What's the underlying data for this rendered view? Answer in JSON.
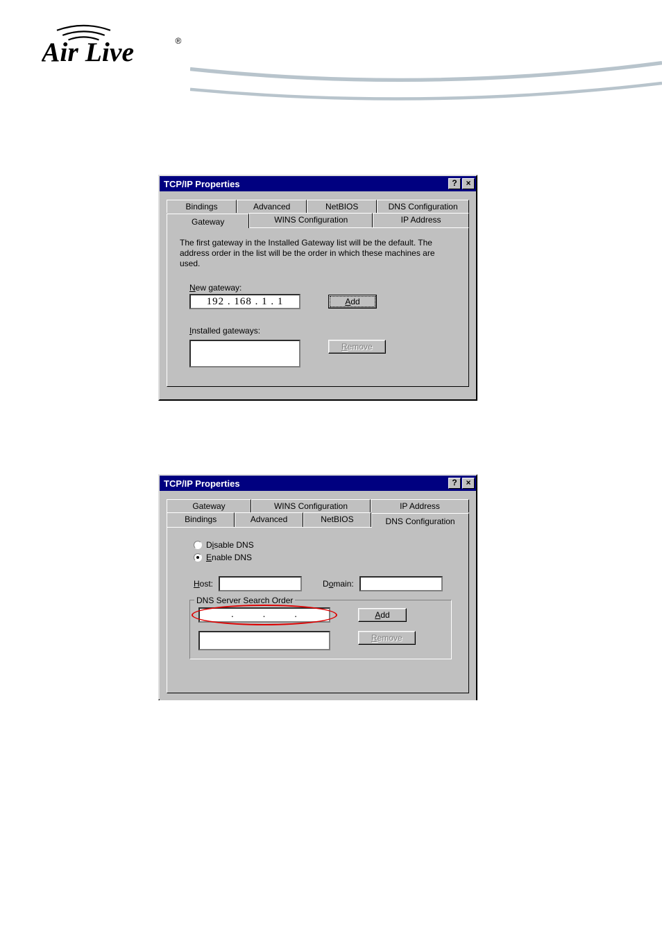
{
  "brand": "Air Live",
  "dialog1": {
    "title": "TCP/IP Properties",
    "helpGlyph": "?",
    "closeGlyph": "×",
    "tabs_row1": {
      "bindings": "Bindings",
      "advanced": "Advanced",
      "netbios": "NetBIOS",
      "dns": "DNS Configuration"
    },
    "tabs_row2": {
      "gateway": "Gateway",
      "wins": "WINS Configuration",
      "ip": "IP Address"
    },
    "description": "The first gateway in the Installed Gateway list will be the default. The address order in the list will be the order in which these machines are used.",
    "new_gateway_label": "New gateway:",
    "new_gateway_value": "192 . 168 .   1  .   1",
    "add_label": "Add",
    "installed_label": "Installed gateways:",
    "remove_label": "Remove"
  },
  "dialog2": {
    "title": "TCP/IP Properties",
    "helpGlyph": "?",
    "closeGlyph": "×",
    "tabs_row1": {
      "gateway": "Gateway",
      "wins": "WINS Configuration",
      "ip": "IP Address"
    },
    "tabs_row2": {
      "bindings": "Bindings",
      "advanced": "Advanced",
      "netbios": "NetBIOS",
      "dns": "DNS Configuration"
    },
    "disable_dns": "Disable DNS",
    "enable_dns": "Enable DNS",
    "host_label": "Host:",
    "domain_label": "Domain:",
    "search_order_label": "DNS Server Search Order",
    "add_label": "Add",
    "remove_label": "Remove",
    "dot": "."
  }
}
